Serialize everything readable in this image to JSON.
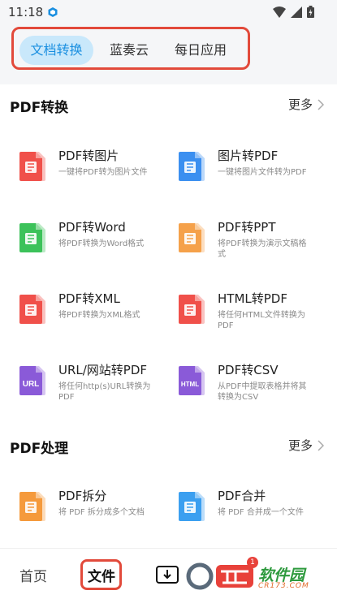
{
  "status_bar": {
    "time": "11:18"
  },
  "top_tabs": [
    {
      "label": "文档转换",
      "active": true
    },
    {
      "label": "蓝奏云",
      "active": false
    },
    {
      "label": "每日应用",
      "active": false
    }
  ],
  "sections": {
    "convert": {
      "title": "PDF转换",
      "more": "更多",
      "items": [
        {
          "title": "PDF转图片",
          "desc": "一键将PDF转为图片文件",
          "icon": "pdf-to-image-icon",
          "color": "#f0504a"
        },
        {
          "title": "图片转PDF",
          "desc": "一键将图片文件转为PDF",
          "icon": "image-to-pdf-icon",
          "color": "#3b8ff0"
        },
        {
          "title": "PDF转Word",
          "desc": "将PDF转换为Word格式",
          "icon": "pdf-to-word-icon",
          "color": "#3cc25a"
        },
        {
          "title": "PDF转PPT",
          "desc": "将PDF转换为演示文稿格式",
          "icon": "pdf-to-ppt-icon",
          "color": "#f5a14a"
        },
        {
          "title": "PDF转XML",
          "desc": "将PDF转换为XML格式",
          "icon": "pdf-to-xml-icon",
          "color": "#f0504a"
        },
        {
          "title": "HTML转PDF",
          "desc": "将任何HTML文件转换为PDF",
          "icon": "html-to-pdf-icon",
          "color": "#f0504a"
        },
        {
          "title": "URL/网站转PDF",
          "desc": "将任何http(s)URL转换为PDF",
          "icon": "url-to-pdf-icon",
          "color": "#8a5ad8",
          "badge": "URL"
        },
        {
          "title": "PDF转CSV",
          "desc": "从PDF中提取表格并将其转换为CSV",
          "icon": "pdf-to-csv-icon",
          "color": "#8a5ad8",
          "badge": "HTML"
        }
      ]
    },
    "process": {
      "title": "PDF处理",
      "more": "更多",
      "items": [
        {
          "title": "PDF拆分",
          "desc": "将 PDF 拆分成多个文档",
          "icon": "pdf-split-icon",
          "color": "#f59a3c"
        },
        {
          "title": "PDF合并",
          "desc": "将 PDF 合并成一个文件",
          "icon": "pdf-merge-icon",
          "color": "#3b9ff0"
        }
      ]
    }
  },
  "bottom_nav": {
    "home": "首页",
    "file": "文件",
    "badge_count": "1"
  },
  "watermark": {
    "text": "软件园",
    "sub": "CR173.COM"
  }
}
